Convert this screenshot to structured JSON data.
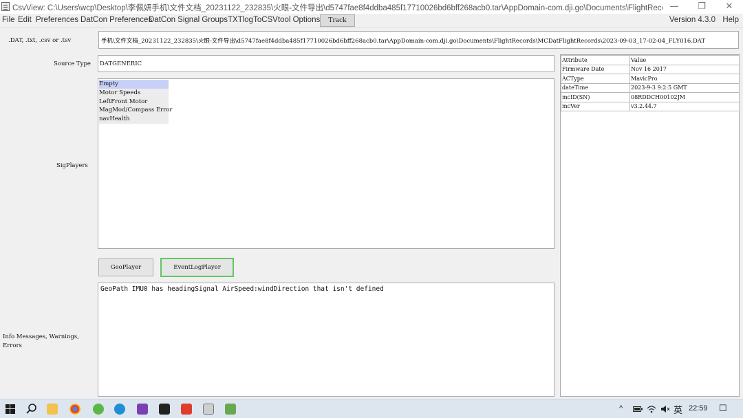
{
  "window": {
    "title": "CsvView: C:\\Users\\wcp\\Desktop\\李佩妍手机\\文件文档_20231122_232835\\火眼-文件导出\\d5747fae8f4ddba485f17710026bd6bff268acb0.tar\\AppDomain-com.dji.go\\Documents\\FlightRecords\\M...",
    "minimize": "—",
    "restore": "❐",
    "close": "✕"
  },
  "menu": {
    "items": [
      "File",
      "Edit",
      "Preferences",
      "DatCon Preferences",
      "DatCon Signal Groups",
      "TXTlogToCSVtool Options"
    ],
    "track_button": "Track",
    "version": "Version 4.3.0",
    "help": "Help"
  },
  "form": {
    "path_label": ".DAT, .txt, .csv or .tsv",
    "path_value": "手机\\文件文档_20231122_232835\\火眼-文件导出\\d5747fae8f4ddba485f17710026bd6bff268acb0.tar\\AppDomain-com.dji.go\\Documents\\FlightRecords\\MCDatFlightRecords\\2023-09-03_17-02-04_FLY016.DAT",
    "source_type_label": "Source Type",
    "source_type_value": "DATGENERIC",
    "sigplayers_label": "SigPlayers",
    "sigplayers": [
      "Empty",
      "Motor Speeds",
      "LeftFront Motor",
      "MagMod/Compass Error",
      "navHealth"
    ],
    "geoplayer_button": "GeoPlayer",
    "eventlogplayer_button": "EventLogPlayer",
    "info_label_line1": "Info Messages, Warnings,",
    "info_label_line2": "Errors",
    "info_message": "GeoPath IMU0 has headingSignal AirSpeed:windDirection that isn't defined"
  },
  "attributes": {
    "header": [
      "Attribute",
      "Value"
    ],
    "rows": [
      [
        "Firmware Date",
        "Nov 16 2017"
      ],
      [
        "ACType",
        "MavicPro"
      ],
      [
        "dateTime",
        "2023-9-3 9:2:5 GMT"
      ],
      [
        "mcID(SN)",
        "08RDDCH00102JM"
      ],
      [
        "mcVer",
        "v3.2.44.7"
      ]
    ]
  },
  "taskbar": {
    "tray_expand": "^",
    "ime": "英",
    "clock": "22:59",
    "notification": "☐"
  }
}
